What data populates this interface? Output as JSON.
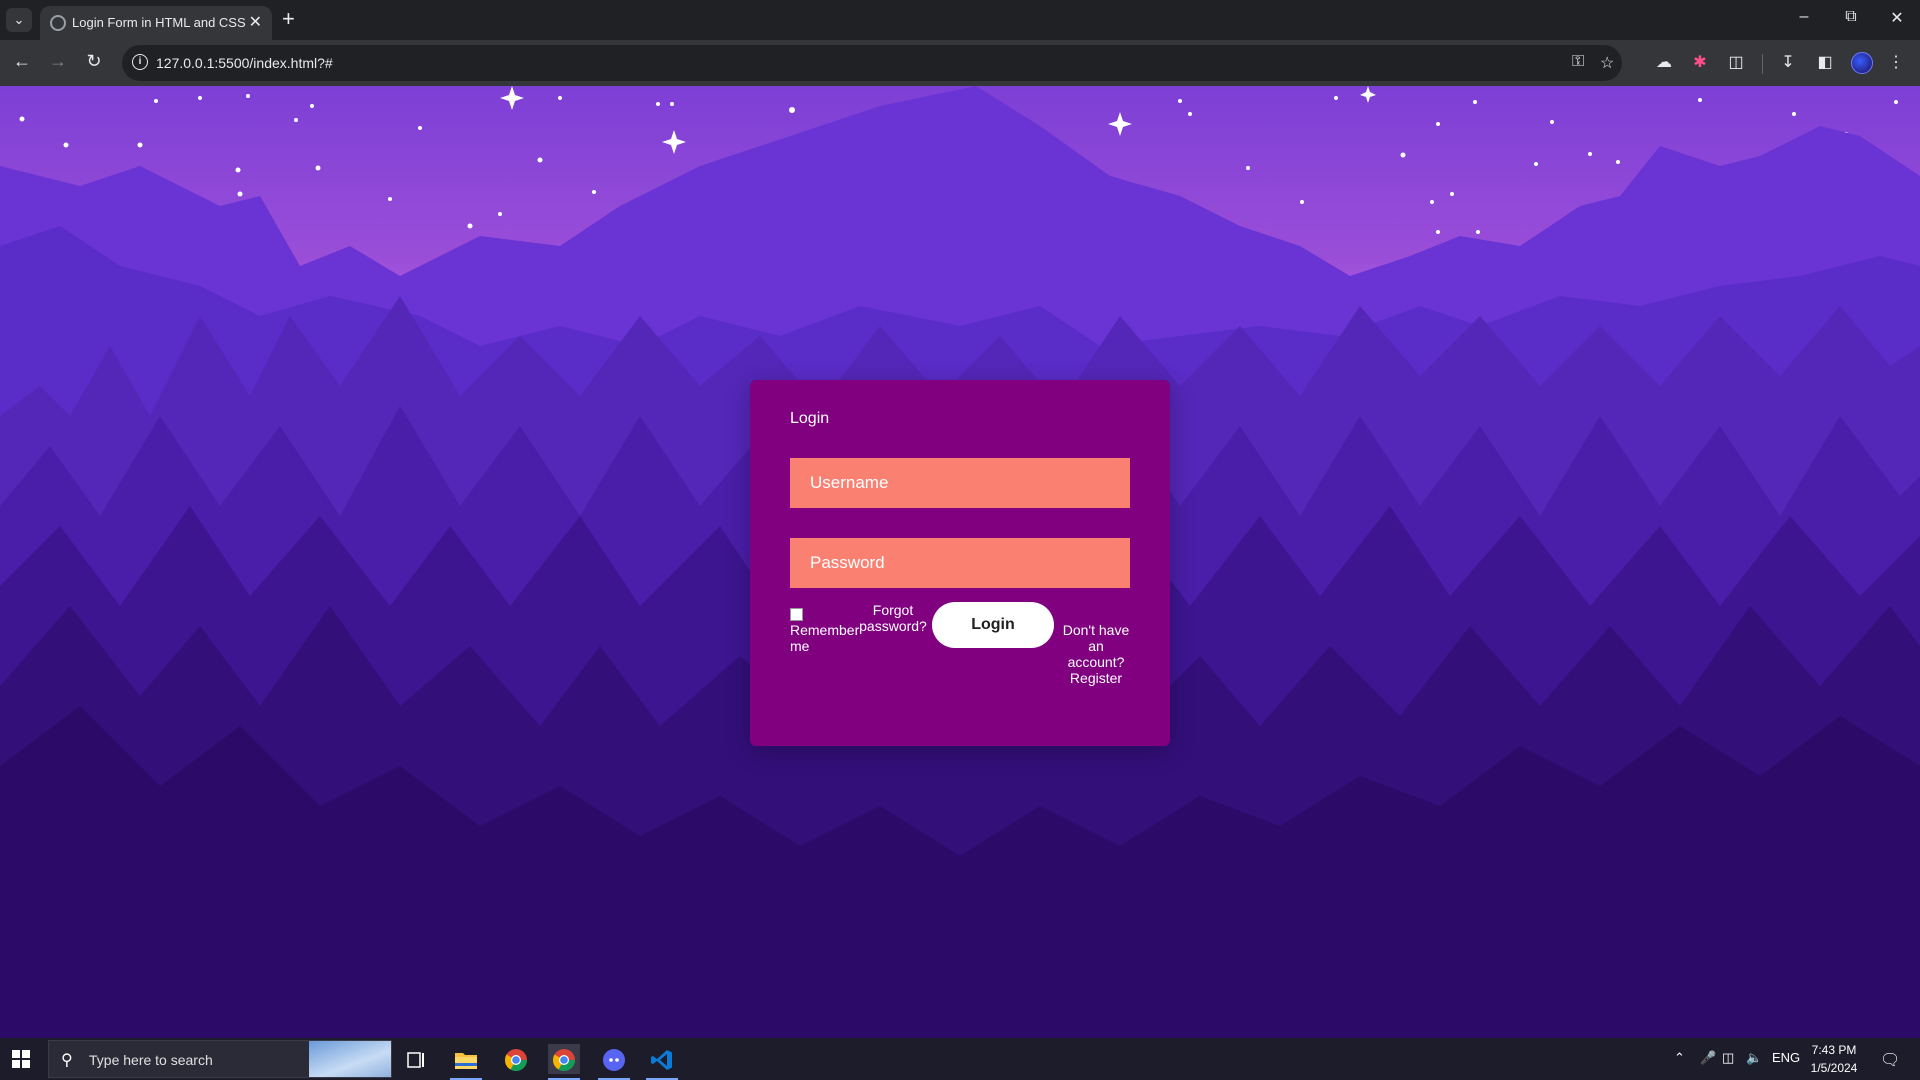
{
  "browser": {
    "tab_title": "Login Form in HTML and CSS",
    "url": "127.0.0.1:5500/index.html?#"
  },
  "form": {
    "title": "Login",
    "username_placeholder": "Username",
    "password_placeholder": "Password",
    "remember_label": "Remember me",
    "forgot_label": "Forgot password?",
    "login_label": "Login",
    "register_prompt": "Don't have an account?",
    "register_link": "Register"
  },
  "colors": {
    "card": "#800080",
    "input": "#fa8072",
    "button": "#ffffff"
  },
  "taskbar": {
    "search_placeholder": "Type here to search",
    "language": "ENG",
    "time": "7:43 PM",
    "date": "1/5/2024",
    "apps": [
      "task-view-icon",
      "file-explorer-icon",
      "chrome-icon",
      "chrome-icon",
      "discord-icon",
      "vscode-icon"
    ]
  }
}
